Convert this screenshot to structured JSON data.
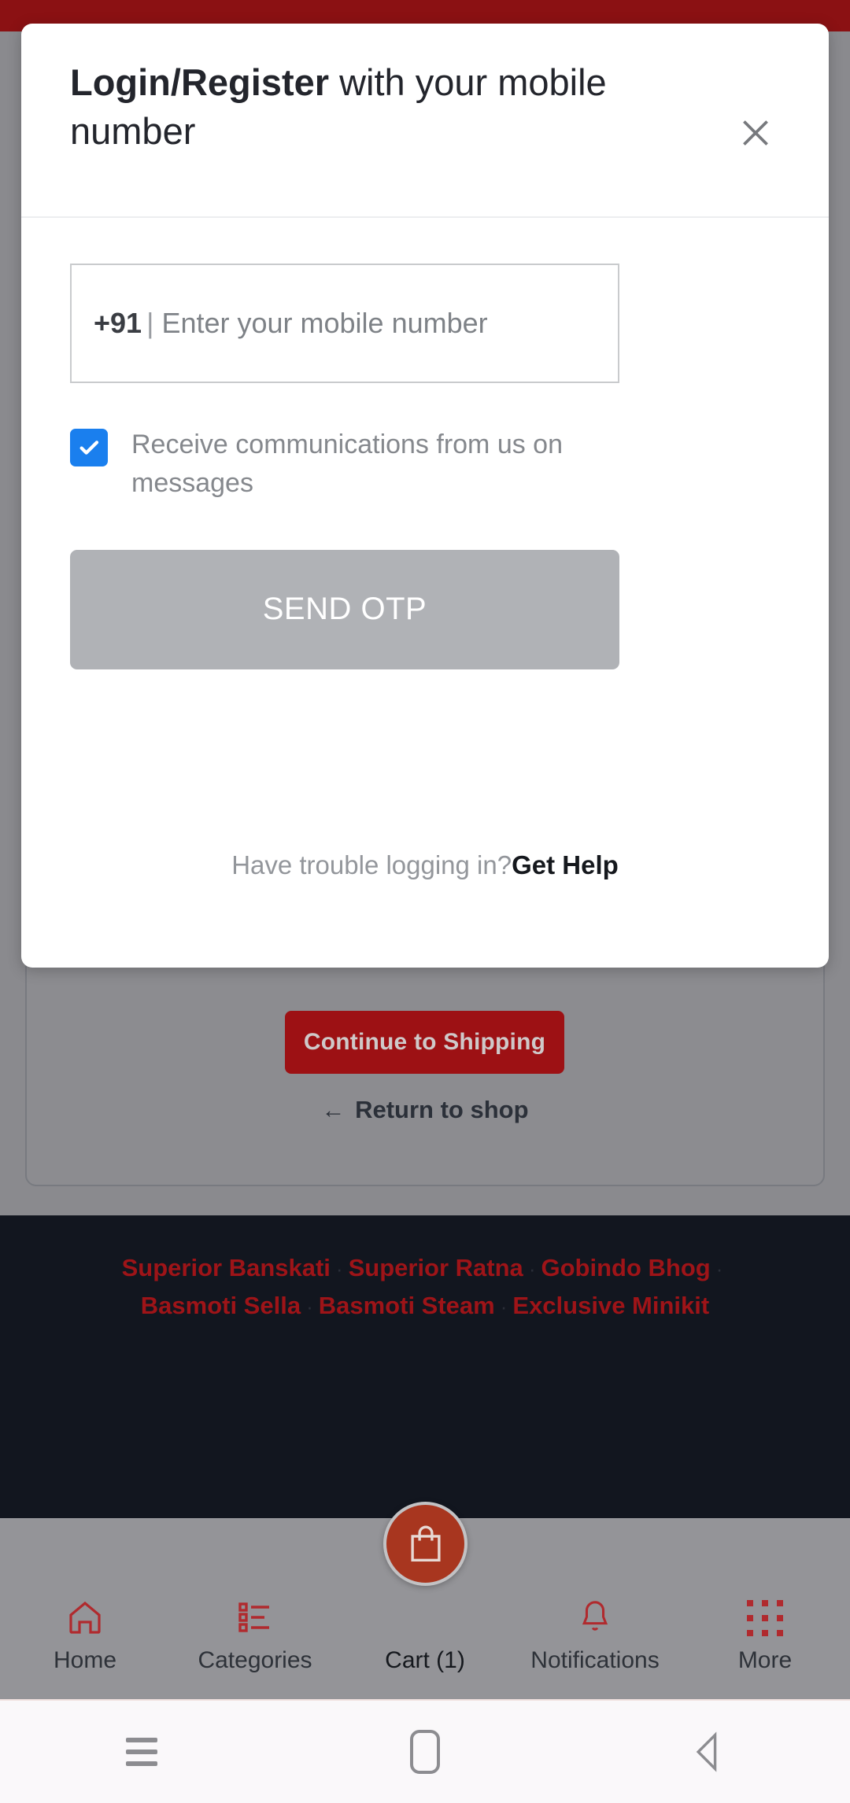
{
  "background": {
    "continue_button": "Continue to Shipping",
    "return_link": "Return to shop",
    "return_arrow": "←",
    "accent_red": "#9d1114",
    "topbar_color": "#8B1113",
    "overlay_color": "#8a8a8e"
  },
  "footer": {
    "background": "#12161f",
    "link_color": "#9e1418",
    "separator": "·",
    "links": [
      "Superior Banskati",
      "Superior Ratna",
      "Gobindo Bhog",
      "Basmoti Sella",
      "Basmoti Steam",
      "Exclusive Minikit"
    ]
  },
  "bottom_nav": {
    "items": [
      {
        "label": "Home",
        "icon": "home-icon"
      },
      {
        "label": "Categories",
        "icon": "list-icon"
      },
      {
        "label": "Cart (1)",
        "icon": "shopping-bag-icon"
      },
      {
        "label": "Notifications",
        "icon": "bell-icon"
      },
      {
        "label": "More",
        "icon": "grid-dots-icon"
      }
    ],
    "cart_fab_color": "#a8361f",
    "icon_color": "#b02a2e"
  },
  "system_nav": {
    "recents": "recents-icon",
    "home": "home-square-icon",
    "back": "back-triangle-icon"
  },
  "modal": {
    "title_bold": "Login/Register",
    "title_rest": " with your mobile number",
    "close_icon": "close-icon",
    "phone": {
      "country_code": "+91",
      "divider": "|",
      "placeholder": "Enter your mobile number",
      "value": ""
    },
    "consent": {
      "checked": true,
      "label": "Receive communications from us on messages",
      "checkbox_color": "#1a7fee"
    },
    "send_otp_label": "SEND OTP",
    "send_otp_disabled": true,
    "help_question": "Have trouble logging in?",
    "help_link": "Get Help"
  }
}
